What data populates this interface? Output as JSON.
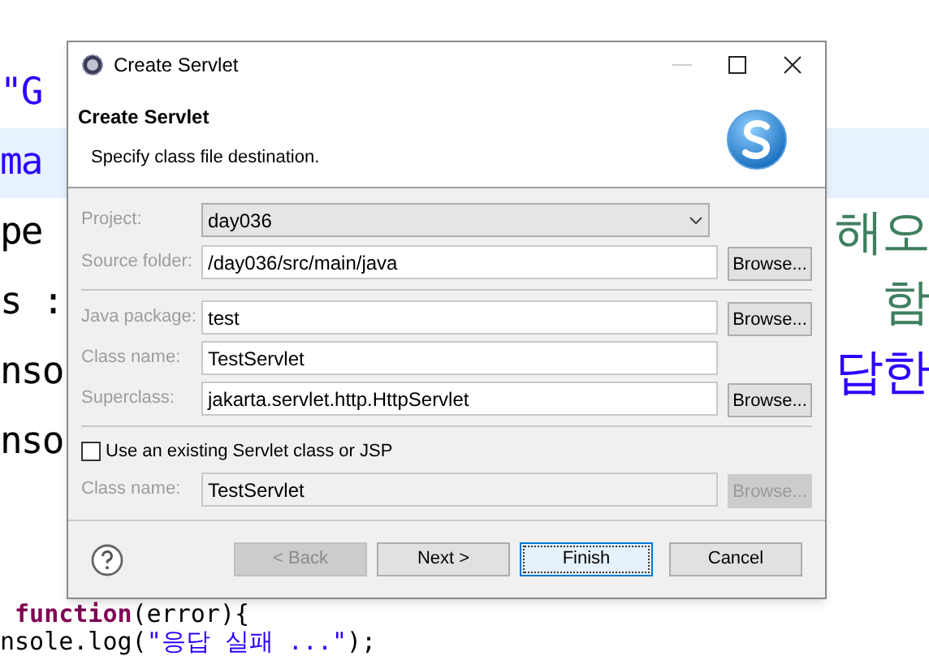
{
  "editor": {
    "lines": [
      {
        "current": false,
        "segments": [
          {
            "text": "\"G",
            "kind": "string"
          }
        ]
      },
      {
        "current": true,
        "segments": [
          {
            "text": "ma",
            "kind": "string"
          }
        ]
      },
      {
        "current": false,
        "segments": [
          {
            "text": "pe",
            "kind": "plain"
          }
        ],
        "right": {
          "text": "해오",
          "kind": "comment"
        }
      },
      {
        "current": false,
        "segments": [
          {
            "text": "s :",
            "kind": "plain"
          }
        ],
        "right": {
          "text": "함",
          "kind": "comment"
        }
      },
      {
        "current": false,
        "segments": [
          {
            "text": "nso",
            "kind": "plain"
          }
        ],
        "right": {
          "text": "답한",
          "kind": "string"
        }
      },
      {
        "current": false,
        "segments": [
          {
            "text": "nso",
            "kind": "plain"
          }
        ]
      }
    ],
    "lines_bottom": [
      {
        "current": false,
        "segments": [
          {
            "text": " function",
            "kind": "keyword"
          },
          {
            "text": "(error){",
            "kind": "plain"
          }
        ]
      },
      {
        "current": false,
        "segments": [
          {
            "text": "nsole.log(",
            "kind": "plain"
          },
          {
            "text": "\"응답 실패 ...\"",
            "kind": "string"
          },
          {
            "text": ");",
            "kind": "plain"
          }
        ]
      }
    ]
  },
  "dialog": {
    "title": "Create Servlet",
    "header": "Create Servlet",
    "subtitle": "Specify class file destination.",
    "project": {
      "label": "Project:",
      "value": "day036"
    },
    "source_folder": {
      "label": "Source folder:",
      "value": "/day036/src/main/java",
      "browse": "Browse..."
    },
    "java_package": {
      "label": "Java package:",
      "value": "test",
      "browse": "Browse..."
    },
    "class_name": {
      "label": "Class name:",
      "value": "TestServlet"
    },
    "superclass": {
      "label": "Superclass:",
      "value": "jakarta.servlet.http.HttpServlet",
      "browse": "Browse..."
    },
    "existing": {
      "label": "Use an existing Servlet class or JSP",
      "checked": false
    },
    "existing_class": {
      "label": "Class name:",
      "value": "TestServlet",
      "browse": "Browse...",
      "disabled": true
    },
    "buttons": [
      {
        "label": "< Back",
        "disabled": true,
        "focused": false
      },
      {
        "label": "Next >",
        "disabled": false,
        "focused": false
      },
      {
        "label": "Finish",
        "disabled": false,
        "focused": true
      },
      {
        "label": "Cancel",
        "disabled": false,
        "focused": false
      }
    ]
  }
}
